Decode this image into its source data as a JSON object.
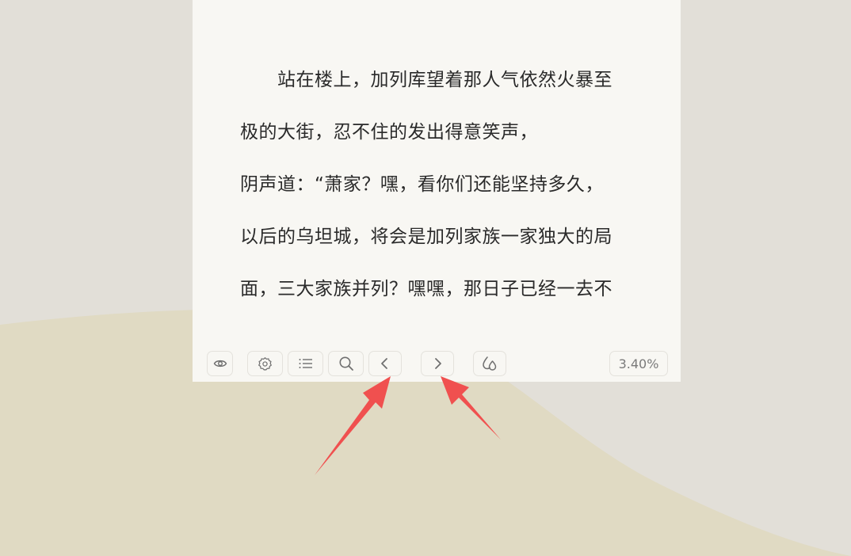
{
  "reader": {
    "lines": [
      "站在楼上，加列库望着那人气依然火暴至",
      "极的大街，忍不住的发出得意笑声，",
      "阴声道：“萧家？嘿，看你们还能坚持多久，",
      "以后的乌坦城，将会是加列家族一家独大的局",
      "面，三大家族并列？嘿嘿，那日子已经一去不"
    ]
  },
  "toolbar": {
    "buttons": [
      {
        "name": "eye-toggle-button",
        "icon": "eye-icon"
      },
      {
        "name": "settings-button",
        "icon": "gear-icon"
      },
      {
        "name": "table-of-contents-button",
        "icon": "list-icon"
      },
      {
        "name": "search-button",
        "icon": "search-icon"
      },
      {
        "name": "previous-page-button",
        "icon": "chevron-left-icon"
      },
      {
        "name": "next-page-button",
        "icon": "chevron-right-icon"
      },
      {
        "name": "theme-button",
        "icon": "droplet-icon"
      }
    ],
    "progress": "3.40%"
  },
  "colors": {
    "page_background": "#e2dfd8",
    "wave": "#e0dac3",
    "reader_paper": "#f8f7f3",
    "annotation_arrow": "#f0504f"
  }
}
